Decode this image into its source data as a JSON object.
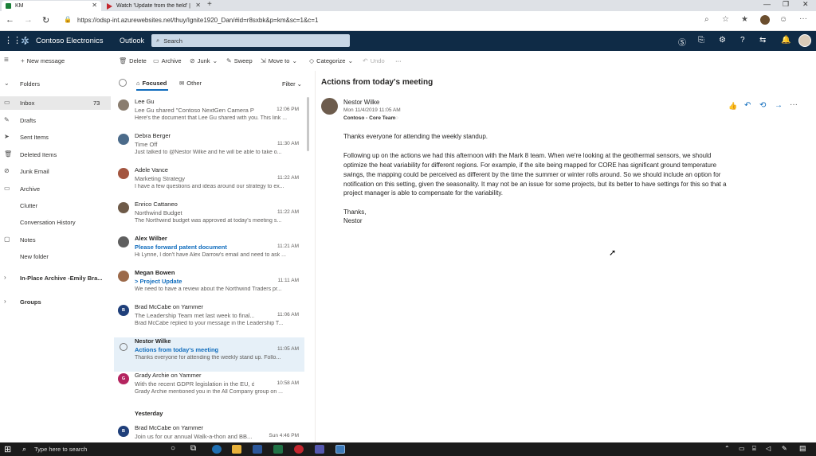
{
  "browser": {
    "tabs": [
      {
        "label": "KM"
      },
      {
        "label": "Watch 'Update from the field' | I..."
      }
    ],
    "url": "https://odsp-int.azurewebsites.net/thuy/Ignite1920_Dan/#id=r8sxbk&p=km&sc=1&c=1"
  },
  "suite": {
    "brand": "Contoso Electronics",
    "app": "Outlook",
    "search_placeholder": "Search"
  },
  "toolbar": {
    "new_message": "New message",
    "delete": "Delete",
    "archive": "Archive",
    "junk": "Junk",
    "sweep": "Sweep",
    "move_to": "Move to",
    "categorize": "Categorize",
    "undo": "Undo",
    "more": "···"
  },
  "folders": {
    "header": "Folders",
    "items": [
      {
        "label": "Inbox",
        "count": "73"
      },
      {
        "label": "Drafts"
      },
      {
        "label": "Sent Items"
      },
      {
        "label": "Deleted Items"
      },
      {
        "label": "Junk Email"
      },
      {
        "label": "Archive"
      },
      {
        "label": "Clutter"
      },
      {
        "label": "Conversation History"
      },
      {
        "label": "Notes"
      },
      {
        "label": "New folder"
      },
      {
        "label": "In-Place Archive -Emily Bra..."
      },
      {
        "label": "Groups"
      }
    ]
  },
  "list": {
    "tab_focused": "Focused",
    "tab_other": "Other",
    "filter": "Filter",
    "yesterday_label": "Yesterday",
    "messages": [
      {
        "sender": "Lee Gu",
        "subject": "Lee Gu shared \"Contoso NextGen Camera Pr...",
        "time": "12:06 PM",
        "preview": "Here's the document that Lee Gu shared with you. This link ..."
      },
      {
        "sender": "Debra Berger",
        "subject": "Time Off",
        "time": "11:30 AM",
        "preview": "Just talked to @Nestor Wilke and he will be able to take o..."
      },
      {
        "sender": "Adele Vance",
        "subject": "Marketing Strategy",
        "time": "11:22 AM",
        "preview": "I have a few questions and ideas around our strategy to ex..."
      },
      {
        "sender": "Enrico Cattaneo",
        "subject": "Northwind Budget",
        "time": "11:22 AM",
        "preview": "The Northwind budget was approved at today's meeting s..."
      },
      {
        "sender": "Alex Wilber",
        "subject": "Please forward patent document",
        "time": "11:21 AM",
        "preview": "Hi Lynne, I don't have Alex Darrow's email and need to ask ..."
      },
      {
        "sender": "Megan Bowen",
        "subject": "> Project Update",
        "time": "11:11 AM",
        "preview": "We need to have a review about the Northwind Traders pr..."
      },
      {
        "sender": "Brad McCabe on Yammer",
        "subject": "The Leadership Team met last week to final...",
        "time": "11:06 AM",
        "preview": "Brad McCabe replied to your message in the Leadership T..."
      },
      {
        "sender": "Nestor Wilke",
        "subject": "Actions from today's meeting",
        "time": "11:05 AM",
        "preview": "Thanks everyone for attending the weekly stand up. Follo..."
      },
      {
        "sender": "Grady Archie on Yammer",
        "subject": "With the recent GDPR legislation in the EU, d...",
        "time": "10:58 AM",
        "preview": "Grady Archie mentioned you in the All Company group on ..."
      },
      {
        "sender": "Brad McCabe on Yammer",
        "subject": "Join us for our annual Walk-a-thon and BB...",
        "time": "Sun 4:46 PM",
        "preview": ""
      }
    ]
  },
  "reading": {
    "subject": "Actions from today's meeting",
    "from": "Nestor Wilke",
    "date": "Mon 11/4/2019 11:05 AM",
    "to": "Contoso - Core Team",
    "greeting": "Thanks everyone for attending the weekly standup.",
    "para_lines": [
      "Following up on the actions we had this afternoon with the Mark 8 team. When we're looking at the geothermal sensors, we should",
      "optimize the heat variability for different regions. For example, if the site being mapped for CORE has significant ground temperature",
      "swings, the mapping could be perceived as different by the time the summer or winter rolls around. So we should include an option for",
      "notification on this setting, given the seasonality. It may not be an issue for some projects, but its better to have settings for this so that a",
      "project manager is able to compensate for the variability."
    ],
    "signoff": "Thanks,",
    "signature": "Nestor"
  },
  "taskbar": {
    "search_placeholder": "Type here to search"
  },
  "colors": {
    "suite_bg": "#0f2b46",
    "accent": "#0f6cbd",
    "selected_bg": "#e6f0f8"
  }
}
